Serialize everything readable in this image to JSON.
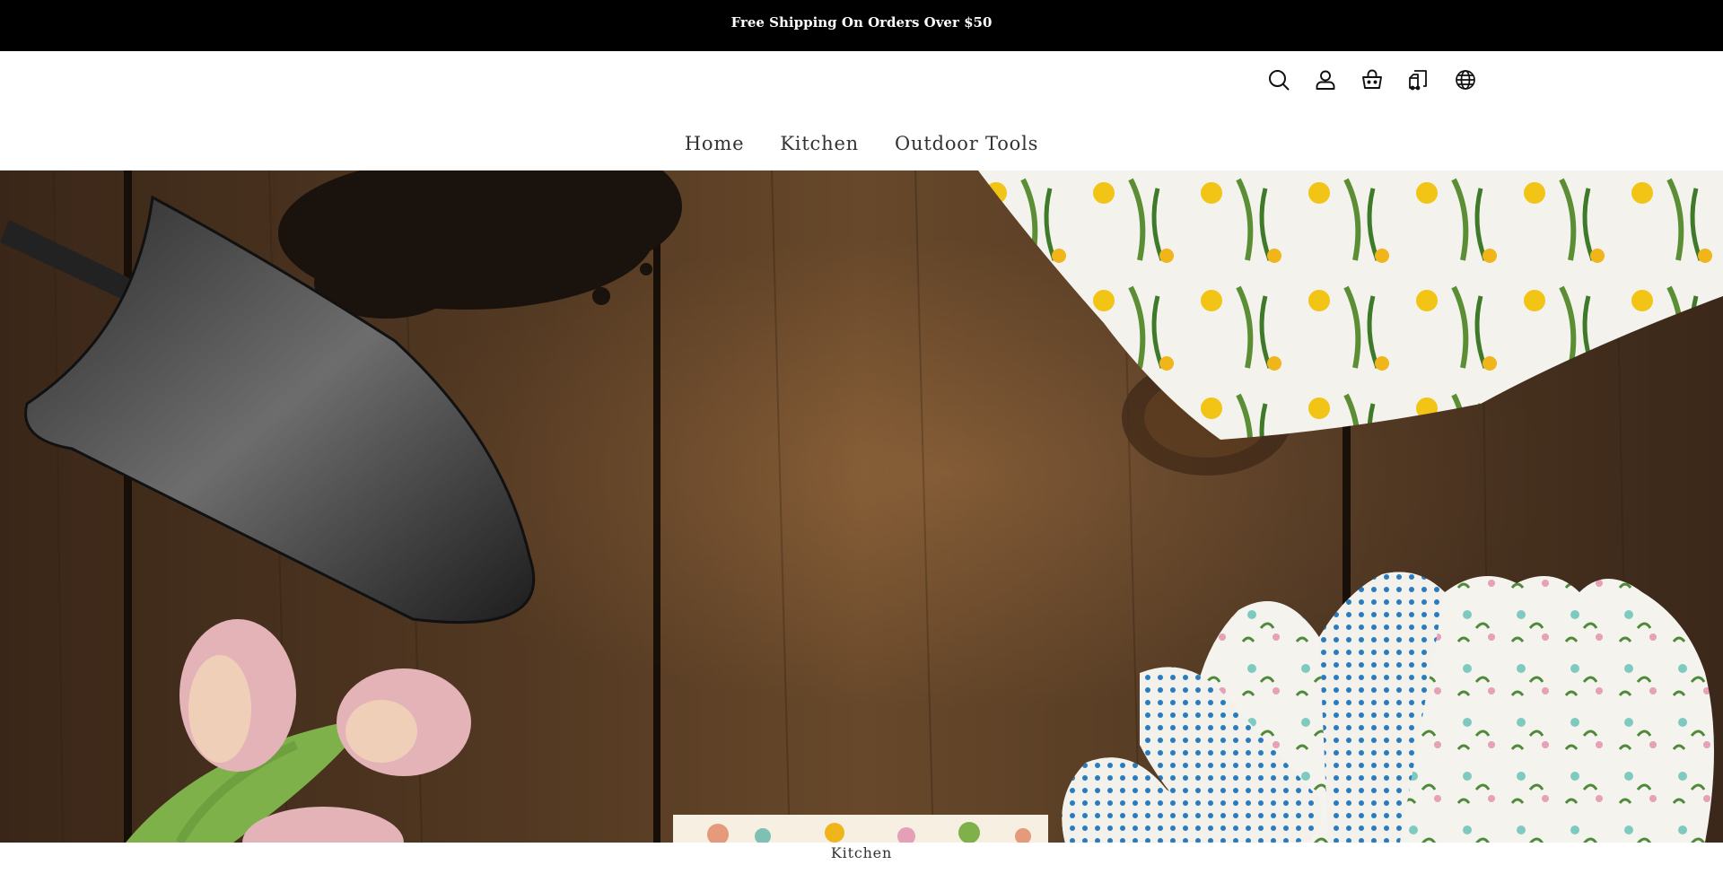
{
  "announcement": {
    "text": "Free Shipping On Orders Over $50"
  },
  "header": {
    "icons": [
      {
        "name": "search-icon",
        "label": "Search"
      },
      {
        "name": "account-icon",
        "label": "Account"
      },
      {
        "name": "cart-icon",
        "label": "Cart"
      },
      {
        "name": "order-tracking-icon",
        "label": "Track order"
      },
      {
        "name": "globe-icon",
        "label": "Language"
      }
    ]
  },
  "nav": {
    "items": [
      {
        "label": "Home"
      },
      {
        "label": "Kitchen"
      },
      {
        "label": "Outdoor Tools"
      }
    ]
  },
  "hero": {
    "image": "garden tools on wooden table: trowel, tulips, floral gloves, floral fabric"
  },
  "caption": {
    "text": "Kitchen"
  },
  "colors": {
    "announcement_bg": "#000000",
    "announcement_text": "#ffffff",
    "nav_text": "#333333",
    "wood": "#6b4a2e"
  }
}
